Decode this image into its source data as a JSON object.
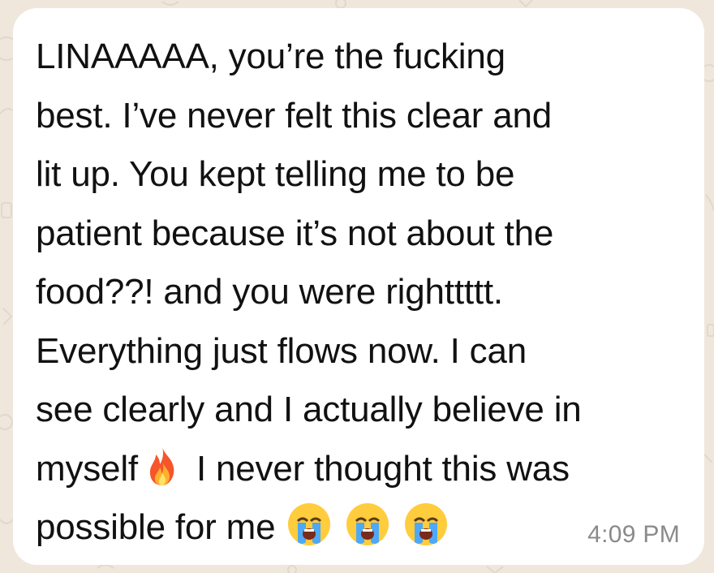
{
  "message": {
    "lines": [
      [
        "LINAAAAA, you’re the fucking"
      ],
      [
        "best. I’ve never felt this clear and"
      ],
      [
        "lit up. You kept telling me to be"
      ],
      [
        "patient because it’s not about the"
      ],
      [
        "food??! and you were righttttt."
      ],
      [
        "Everything just flows now. I can"
      ],
      [
        "see clearly and I actually believe in"
      ],
      [
        "myself",
        " I never thought this was"
      ],
      [
        "possible for me"
      ]
    ],
    "emojis": {
      "fire": "🔥",
      "crying": "😭"
    },
    "timestamp": "4:09 PM"
  },
  "colors": {
    "bubble": "#ffffff",
    "wallpaper": "#efe7dc",
    "text": "#111111",
    "timestamp": "#8a8a8a"
  }
}
